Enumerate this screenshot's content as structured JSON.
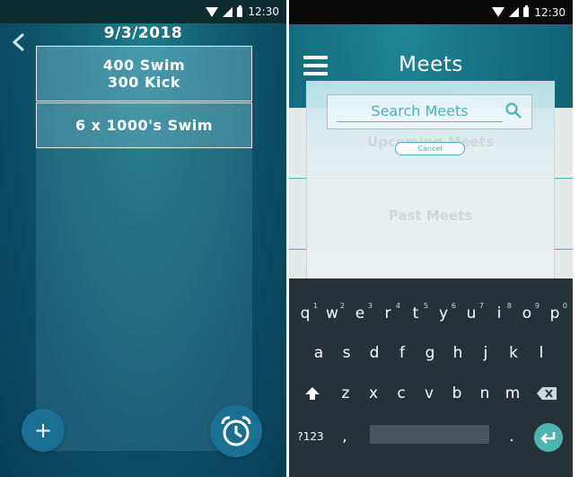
{
  "left_screen": {
    "status_time": "12:30",
    "date_title": "9/3/2018",
    "workouts": [
      {
        "line1": "400 Swim",
        "line2": "300 Kick"
      },
      {
        "line1": "6 x 1000's Swim",
        "line2": ""
      }
    ],
    "add_button": "+",
    "icons": {
      "back": "chevron-left-icon",
      "timer": "alarm-clock-icon"
    }
  },
  "right_screen": {
    "status_time": "12:30",
    "title": "Meets",
    "search": {
      "placeholder": "Search Meets",
      "value": ""
    },
    "cancel_label": "Cancel",
    "list": {
      "upcoming": "Upcoming Meets",
      "past": "Past Meets"
    },
    "keyboard": {
      "row1": [
        {
          "k": "q",
          "h": "1"
        },
        {
          "k": "w",
          "h": "2"
        },
        {
          "k": "e",
          "h": "3"
        },
        {
          "k": "r",
          "h": "4"
        },
        {
          "k": "t",
          "h": "5"
        },
        {
          "k": "y",
          "h": "6"
        },
        {
          "k": "u",
          "h": "7"
        },
        {
          "k": "i",
          "h": "8"
        },
        {
          "k": "o",
          "h": "9"
        },
        {
          "k": "p",
          "h": "0"
        }
      ],
      "row2": [
        "a",
        "s",
        "d",
        "f",
        "g",
        "h",
        "j",
        "k",
        "l"
      ],
      "row3": [
        "z",
        "x",
        "c",
        "v",
        "b",
        "n",
        "m"
      ],
      "symbols_key": "?123",
      "comma_key": ",",
      "period_key": "."
    },
    "colors": {
      "accent": "#49b1b7",
      "keyboard_bg": "#263238",
      "enter": "#4db6ac"
    }
  }
}
